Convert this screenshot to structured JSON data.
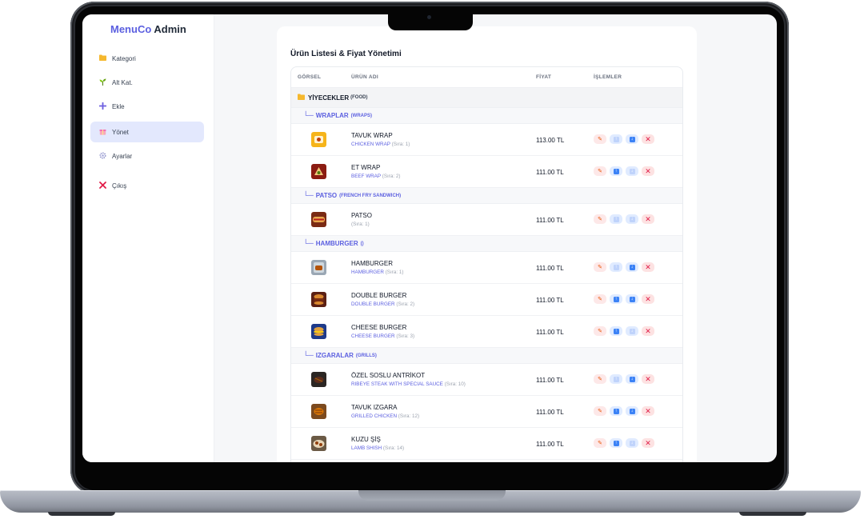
{
  "app": {
    "brand_accent": "MenuCo",
    "brand_rest": " Admin"
  },
  "sidebar": {
    "items": [
      {
        "icon": "folder-icon",
        "label": "Kategori",
        "active": false
      },
      {
        "icon": "sprout-icon",
        "label": "Alt Kat.",
        "active": false
      },
      {
        "icon": "plus-icon",
        "label": "Ekle",
        "active": false
      },
      {
        "icon": "gift-icon",
        "label": "Yönet",
        "active": true
      },
      {
        "icon": "gear-icon",
        "label": "Ayarlar",
        "active": false
      },
      {
        "icon": "close-icon",
        "label": "Çıkış",
        "active": false
      }
    ]
  },
  "main": {
    "title": "Ürün Listesi & Fiyat Yönetimi",
    "columns": {
      "image": "GÖRSEL",
      "name": "ÜRÜN ADI",
      "price": "FİYAT",
      "actions": "İŞLEMLER"
    },
    "category": {
      "name": "YİYECEKLER",
      "sub": "(FOOD)"
    },
    "subcategories": [
      {
        "name": "WRAPLAR",
        "sub": "(WRAPS)"
      },
      {
        "name": "PATSO",
        "sub": "(FRENCH FRY SANDWICH)"
      },
      {
        "name": "HAMBURGER",
        "sub": "()"
      },
      {
        "name": "IZGARALAR",
        "sub": "(GRILLS)"
      }
    ],
    "products": [
      {
        "name": "TAVUK WRAP",
        "en": "CHICKEN WRAP",
        "order": "(Sıra: 1)",
        "price": "113.00 TL"
      },
      {
        "name": "ET WRAP",
        "en": "BEEF WRAP",
        "order": "(Sıra: 2)",
        "price": "111.00 TL"
      },
      {
        "name": "PATSO",
        "en": "",
        "order": "(Sıra: 1)",
        "price": "111.00 TL"
      },
      {
        "name": "HAMBURGER",
        "en": "HAMBURGER",
        "order": "(Sıra: 1)",
        "price": "111.00 TL"
      },
      {
        "name": "DOUBLE BURGER",
        "en": "DOUBLE BURGER",
        "order": "(Sıra: 2)",
        "price": "111.00 TL"
      },
      {
        "name": "CHEESE BURGER",
        "en": "CHEESE BURGER",
        "order": "(Sıra: 3)",
        "price": "111.00 TL"
      },
      {
        "name": "ÖZEL SOSLU ANTRİKOT",
        "en": "RIBEYE STEAK WITH SPECIAL SAUCE",
        "order": "(Sıra: 10)",
        "price": "111.00 TL"
      },
      {
        "name": "TAVUK IZGARA",
        "en": "GRILLED CHICKEN",
        "order": "(Sıra: 12)",
        "price": "111.00 TL"
      },
      {
        "name": "KUZU ŞİŞ",
        "en": "LAMB SHISH",
        "order": "(Sıra: 14)",
        "price": "111.00 TL"
      }
    ],
    "icons": {
      "edit": "pencil-icon",
      "up": "arrow-up-icon",
      "down": "arrow-down-icon",
      "delete": "close-icon"
    }
  },
  "colors": {
    "accent": "#5b5fe0",
    "active_nav": "#e3e8fd",
    "action_blue": "#3b82f6",
    "delete_red": "#e11d48"
  }
}
